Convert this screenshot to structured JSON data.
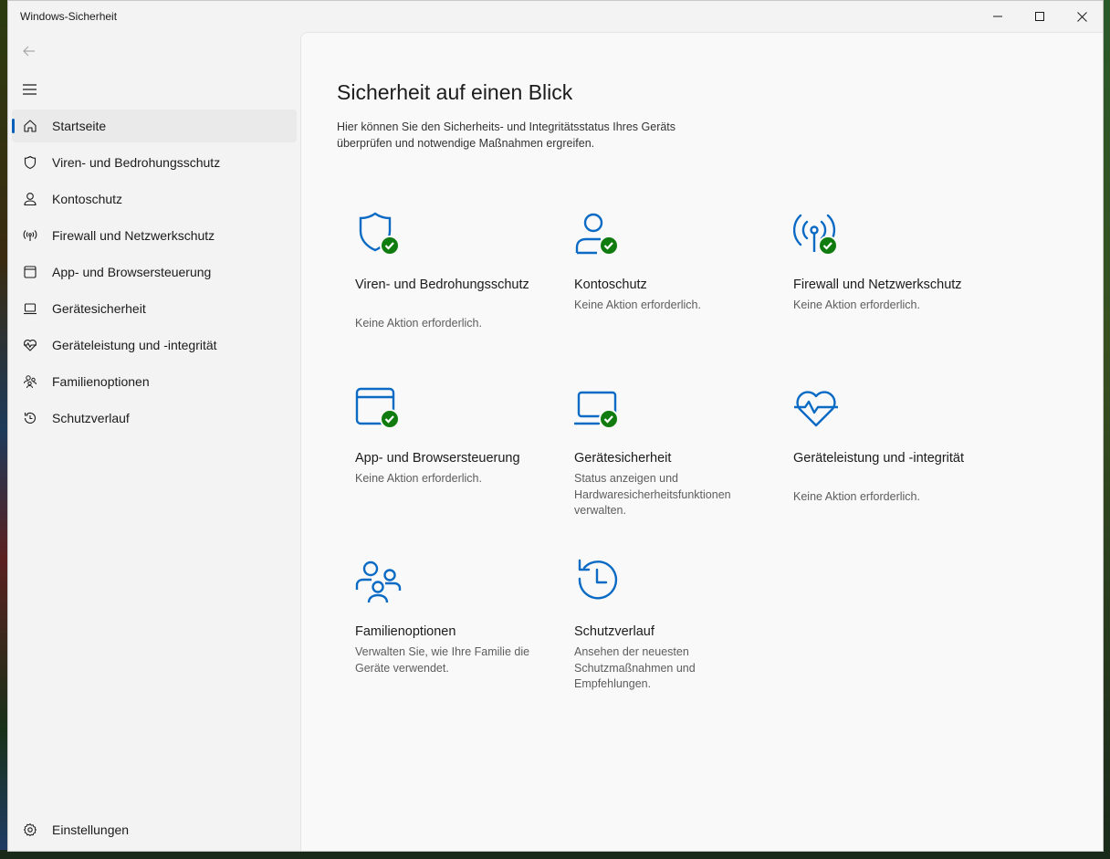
{
  "window": {
    "title": "Windows-Sicherheit",
    "controls": {
      "minimize": "—",
      "maximize": "☐",
      "close": "✕"
    }
  },
  "colors": {
    "accent": "#005fb8",
    "icon_blue": "#0a6ac4",
    "check_green": "#107c10"
  },
  "sidebar": {
    "items": [
      {
        "label": "Startseite",
        "icon": "home-icon",
        "active": true
      },
      {
        "label": "Viren- und Bedrohungsschutz",
        "icon": "shield-icon"
      },
      {
        "label": "Kontoschutz",
        "icon": "person-icon"
      },
      {
        "label": "Firewall und Netzwerkschutz",
        "icon": "antenna-icon"
      },
      {
        "label": "App- und Browsersteuerung",
        "icon": "app-window-icon"
      },
      {
        "label": "Gerätesicherheit",
        "icon": "laptop-icon"
      },
      {
        "label": "Geräteleistung und -integrität",
        "icon": "heart-pulse-icon"
      },
      {
        "label": "Familienoptionen",
        "icon": "family-icon"
      },
      {
        "label": "Schutzverlauf",
        "icon": "history-icon"
      }
    ],
    "settings_label": "Einstellungen"
  },
  "main": {
    "title": "Sicherheit auf einen Blick",
    "description": "Hier können Sie den Sicherheits- und Integritätsstatus Ihres Geräts überprüfen und notwendige Maßnahmen ergreifen.",
    "tiles": [
      {
        "title": "Viren- und Bedrohungsschutz",
        "subtitle": "Keine Aktion erforderlich.",
        "icon": "shield-check-icon"
      },
      {
        "title": "Kontoschutz",
        "subtitle": "Keine Aktion erforderlich.",
        "icon": "person-check-icon"
      },
      {
        "title": "Firewall und Netzwerkschutz",
        "subtitle": "Keine Aktion erforderlich.",
        "icon": "antenna-check-icon"
      },
      {
        "title": "App- und Browsersteuerung",
        "subtitle": "Keine Aktion erforderlich.",
        "icon": "app-window-check-icon"
      },
      {
        "title": "Gerätesicherheit",
        "subtitle": "Status anzeigen und Hardwaresicherheitsfunktionen verwalten.",
        "icon": "laptop-check-icon"
      },
      {
        "title": "Geräteleistung und -integrität",
        "subtitle": "Keine Aktion erforderlich.",
        "icon": "heart-pulse-icon"
      },
      {
        "title": "Familienoptionen",
        "subtitle": "Verwalten Sie, wie Ihre Familie die Geräte verwendet.",
        "icon": "family-icon"
      },
      {
        "title": "Schutzverlauf",
        "subtitle": "Ansehen der neuesten Schutzmaßnahmen und Empfehlungen.",
        "icon": "history-icon"
      }
    ]
  }
}
